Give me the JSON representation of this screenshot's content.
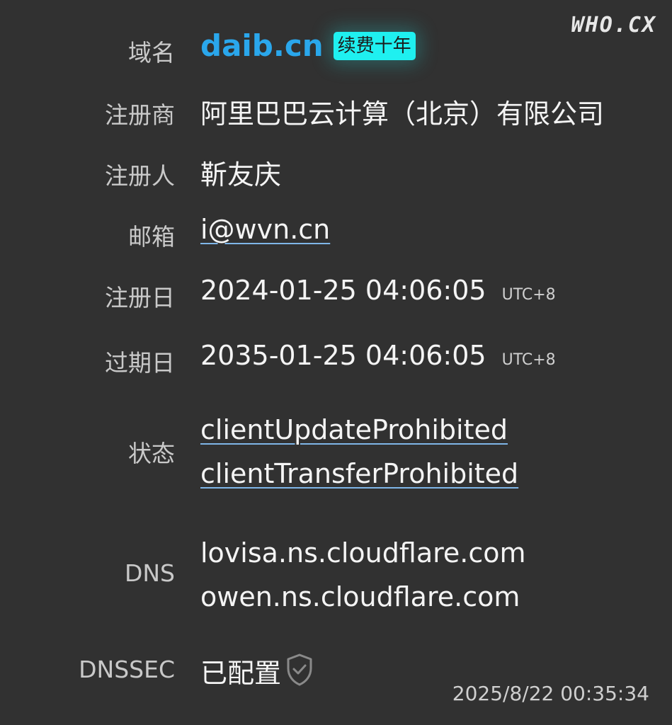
{
  "brand": "WHO.CX",
  "fields": {
    "domain": {
      "label": "域名",
      "value": "daib.cn",
      "badge": "续费十年"
    },
    "registrar": {
      "label": "注册商",
      "value": "阿里巴巴云计算（北京）有限公司"
    },
    "registrant": {
      "label": "注册人",
      "value": "靳友庆"
    },
    "email": {
      "label": "邮箱",
      "value": "i@wvn.cn"
    },
    "created": {
      "label": "注册日",
      "value": "2024-01-25 04:06:05",
      "tz": "UTC+8"
    },
    "expires": {
      "label": "过期日",
      "value": "2035-01-25 04:06:05",
      "tz": "UTC+8"
    },
    "status": {
      "label": "状态",
      "values": [
        "clientUpdateProhibited",
        "clientTransferProhibited"
      ]
    },
    "dns": {
      "label": "DNS",
      "values": [
        "lovisa.ns.cloudflare.com",
        "owen.ns.cloudflare.com"
      ]
    },
    "dnssec": {
      "label": "DNSSEC",
      "value": "已配置",
      "icon": "shield-check-icon"
    }
  },
  "timestamp": "2025/8/22 00:35:34",
  "colors": {
    "background": "#313131",
    "domain": "#2aa7ec",
    "badge": "#1ff0f0",
    "underline": "#7fb6e8"
  }
}
